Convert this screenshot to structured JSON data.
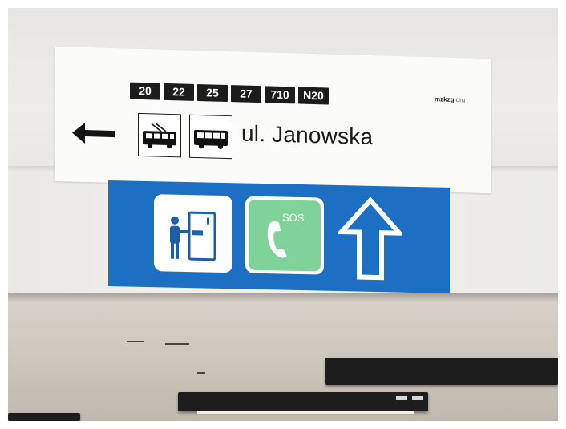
{
  "sign": {
    "lines": [
      "20",
      "22",
      "25",
      "27",
      "710",
      "N20"
    ],
    "brand": "mzkzg",
    "brand_suffix": ".org",
    "street": "ul. Janowska",
    "direction": "left",
    "vehicles": [
      "trolleybus-icon",
      "bus-icon"
    ]
  },
  "info_sign": {
    "sos_label": "SOS",
    "icons": [
      "ticket-machine-icon",
      "sos-phone-icon",
      "up-arrow-icon"
    ],
    "colors": {
      "panel_blue": "#1d6fc4",
      "sos_green": "#7fd39a"
    }
  }
}
